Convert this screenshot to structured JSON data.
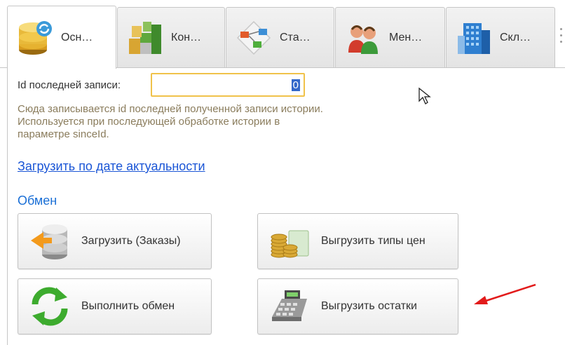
{
  "tabs": [
    {
      "label": "Осн…",
      "icon": "database-icon",
      "active": true
    },
    {
      "label": "Кон…",
      "icon": "colored-cubes-icon",
      "active": false
    },
    {
      "label": "Ста…",
      "icon": "flowchart-icon",
      "active": false
    },
    {
      "label": "Мен…",
      "icon": "users-icon",
      "active": false
    },
    {
      "label": "Скл…",
      "icon": "warehouse-building-icon",
      "active": false
    }
  ],
  "form": {
    "last_id_label": "Id последней записи:",
    "last_id_value": "0",
    "hint_lines": [
      "Сюда записывается id последней полученной записи истории.",
      "Используется при последующей обработке истории в",
      "параметре sinceId."
    ],
    "load_by_date_link": "Загрузить по дате актуальности"
  },
  "exchange": {
    "title": "Обмен",
    "buttons": [
      {
        "label": "Загрузить (Заказы)",
        "icon": "database-import-icon"
      },
      {
        "label": "Выгрузить типы цен",
        "icon": "coins-money-icon"
      },
      {
        "label": "Выполнить обмен",
        "icon": "sync-arrows-icon"
      },
      {
        "label": "Выгрузить остатки",
        "icon": "cash-register-icon"
      }
    ]
  },
  "colors": {
    "link": "#1a55d6",
    "group_title": "#1a6fd6",
    "input_focus_border": "#f0c24a",
    "hint_text": "#8a7c5c",
    "annotation_arrow": "#e21b1b"
  }
}
